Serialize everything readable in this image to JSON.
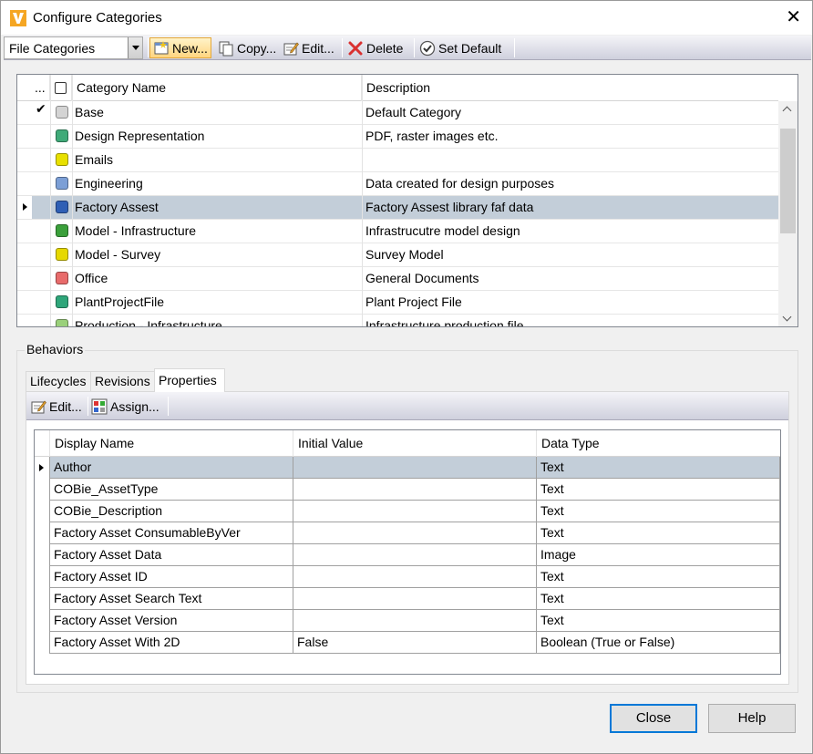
{
  "window": {
    "title": "Configure Categories",
    "app_icon": "vault-logo-icon",
    "close_glyph": "✕"
  },
  "toolbar": {
    "combo_value": "File Categories",
    "buttons": [
      {
        "label": "New...",
        "icon": "new-icon"
      },
      {
        "label": "Copy...",
        "icon": "copy-icon"
      },
      {
        "label": "Edit...",
        "icon": "edit-icon"
      },
      {
        "label": "Delete",
        "icon": "delete-icon"
      },
      {
        "label": "Set Default",
        "icon": "set-default-icon"
      }
    ]
  },
  "categories": {
    "header": {
      "dots": "...",
      "name": "Category Name",
      "description": "Description"
    },
    "rows": [
      {
        "name": "Base",
        "description": "Default Category",
        "color": "#d4d4d4",
        "default": "✔"
      },
      {
        "name": "Design Representation",
        "description": "PDF, raster images etc.",
        "color": "#3faa78",
        "default": ""
      },
      {
        "name": "Emails",
        "description": "",
        "color": "#e8e000",
        "default": ""
      },
      {
        "name": "Engineering",
        "description": "Data created for design purposes",
        "color": "#7c9fd6",
        "default": ""
      },
      {
        "name": "Factory Assest",
        "description": "Factory Assest library faf data",
        "color": "#2f5fb5",
        "default": ""
      },
      {
        "name": "Model - Infrastructure",
        "description": "Infrastrucutre model design",
        "color": "#3ba03b",
        "default": ""
      },
      {
        "name": "Model - Survey",
        "description": "Survey Model",
        "color": "#e6d800",
        "default": ""
      },
      {
        "name": "Office",
        "description": "General Documents",
        "color": "#e86b6b",
        "default": ""
      },
      {
        "name": "PlantProjectFile",
        "description": "Plant Project File",
        "color": "#2fa67a",
        "default": ""
      },
      {
        "name": "Production - Infrastructure",
        "description": "Infrastructure production file",
        "color": "#9ad07a",
        "default": ""
      }
    ],
    "selected_index": 4
  },
  "behaviors": {
    "label": "Behaviors",
    "tabs": [
      "Lifecycles",
      "Revisions",
      "Properties"
    ],
    "active_tab": "Properties",
    "toolbar": [
      {
        "label": "Edit...",
        "icon": "edit-icon"
      },
      {
        "label": "Assign...",
        "icon": "assign-icon"
      }
    ],
    "properties": {
      "header": {
        "display_name": "Display Name",
        "initial_value": "Initial Value",
        "data_type": "Data Type"
      },
      "rows": [
        {
          "display_name": "Author",
          "initial_value": "",
          "data_type": "Text"
        },
        {
          "display_name": "COBie_AssetType",
          "initial_value": "",
          "data_type": "Text"
        },
        {
          "display_name": "COBie_Description",
          "initial_value": "",
          "data_type": "Text"
        },
        {
          "display_name": "Factory Asset ConsumableByVer",
          "initial_value": "",
          "data_type": "Text"
        },
        {
          "display_name": "Factory Asset Data",
          "initial_value": "",
          "data_type": "Image"
        },
        {
          "display_name": "Factory Asset ID",
          "initial_value": "",
          "data_type": "Text"
        },
        {
          "display_name": "Factory Asset Search Text",
          "initial_value": "",
          "data_type": "Text"
        },
        {
          "display_name": "Factory Asset Version",
          "initial_value": "",
          "data_type": "Text"
        },
        {
          "display_name": "Factory Asset With 2D",
          "initial_value": "False",
          "data_type": "Boolean (True or False)"
        }
      ],
      "selected_index": 0
    }
  },
  "footer": {
    "close_label": "Close",
    "help_label": "Help"
  }
}
